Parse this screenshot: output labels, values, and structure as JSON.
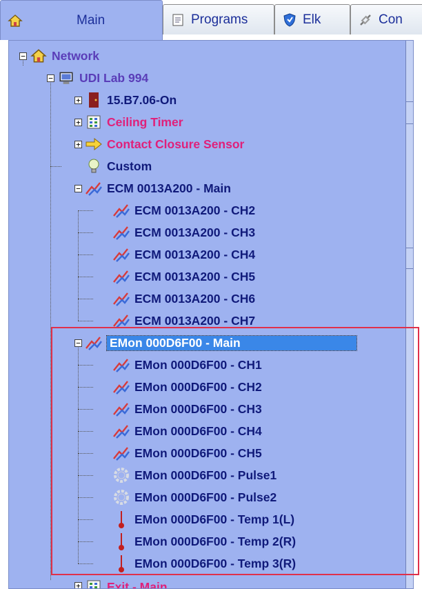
{
  "tabs": [
    {
      "label": "Main",
      "icon": "home-icon",
      "active": true
    },
    {
      "label": "Programs",
      "icon": "document-icon",
      "active": false
    },
    {
      "label": "Elk",
      "icon": "shield-icon",
      "active": false
    },
    {
      "label": "Con",
      "icon": "link-icon",
      "active": false
    }
  ],
  "tree": {
    "root": {
      "label": "Network",
      "icon": "home-icon"
    },
    "lab": {
      "label": "UDI Lab 994",
      "icon": "computer-icon"
    },
    "items": [
      {
        "label": "15.B7.06-On",
        "icon": "door-icon"
      },
      {
        "label": "Ceiling Timer",
        "icon": "grid-icon"
      },
      {
        "label": "Contact Closure Sensor",
        "icon": "arrow-icon"
      },
      {
        "label": "Custom",
        "icon": "bulb-icon"
      },
      {
        "label": "ECM 0013A200 - Main",
        "icon": "meter-icon"
      },
      {
        "label": "ECM 0013A200 - CH2",
        "icon": "meter-icon"
      },
      {
        "label": "ECM 0013A200 - CH3",
        "icon": "meter-icon"
      },
      {
        "label": "ECM 0013A200 - CH4",
        "icon": "meter-icon"
      },
      {
        "label": "ECM 0013A200 - CH5",
        "icon": "meter-icon"
      },
      {
        "label": "ECM 0013A200 - CH6",
        "icon": "meter-icon"
      },
      {
        "label": "ECM 0013A200 - CH7",
        "icon": "meter-icon"
      },
      {
        "label": "EMon 000D6F00 - Main",
        "icon": "meter-icon"
      },
      {
        "label": "EMon 000D6F00 - CH1",
        "icon": "meter-icon"
      },
      {
        "label": "EMon 000D6F00 - CH2",
        "icon": "meter-icon"
      },
      {
        "label": "EMon 000D6F00 - CH3",
        "icon": "meter-icon"
      },
      {
        "label": "EMon 000D6F00 - CH4",
        "icon": "meter-icon"
      },
      {
        "label": "EMon 000D6F00 - CH5",
        "icon": "meter-icon"
      },
      {
        "label": "EMon 000D6F00 - Pulse1",
        "icon": "gear-icon"
      },
      {
        "label": "EMon 000D6F00 - Pulse2",
        "icon": "gear-icon"
      },
      {
        "label": "EMon 000D6F00 - Temp 1(L)",
        "icon": "thermometer-icon"
      },
      {
        "label": "EMon 000D6F00 - Temp 2(R)",
        "icon": "thermometer-icon"
      },
      {
        "label": "EMon 000D6F00 - Temp 3(R)",
        "icon": "thermometer-icon"
      },
      {
        "label": "Exit - Main",
        "icon": "grid-icon"
      }
    ]
  },
  "colors": {
    "panel": "#9eb2f0",
    "selection": "#3a87e8",
    "highlight": "#e0304a"
  }
}
